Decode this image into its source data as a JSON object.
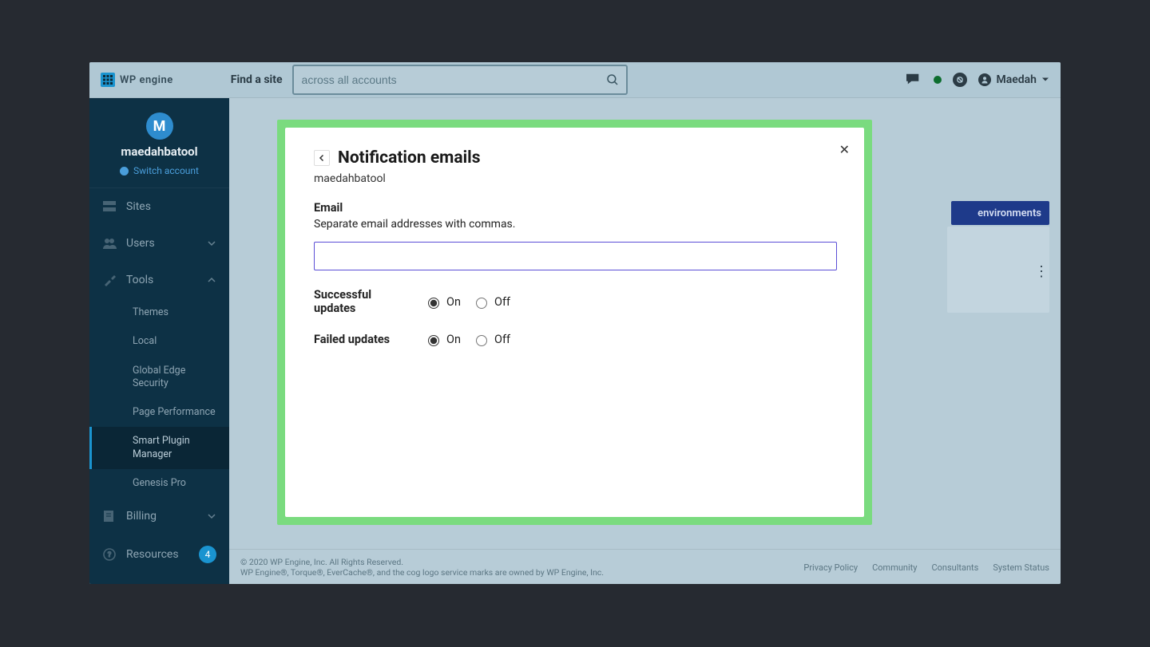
{
  "header": {
    "brand": "WP engine",
    "find_label": "Find a site",
    "search_placeholder": "across all accounts",
    "user_name": "Maedah"
  },
  "sidebar": {
    "avatar_letter": "M",
    "account_name": "maedahbatool",
    "switch_account": "Switch account",
    "nav": {
      "sites": "Sites",
      "users": "Users",
      "tools": "Tools",
      "billing": "Billing",
      "resources": "Resources",
      "resources_badge": "4"
    },
    "tools_sub": {
      "themes": "Themes",
      "local": "Local",
      "ges": "Global Edge Security",
      "page_perf": "Page Performance",
      "spm": "Smart Plugin Manager",
      "genesis": "Genesis Pro"
    }
  },
  "main": {
    "env_button": "environments"
  },
  "modal": {
    "title": "Notification emails",
    "subtitle": "maedahbatool",
    "email_label": "Email",
    "email_help": "Separate email addresses with commas.",
    "successful_label": "Successful updates",
    "failed_label": "Failed updates",
    "on": "On",
    "off": "Off"
  },
  "footer": {
    "copyright": "© 2020 WP Engine, Inc. All Rights Reserved.",
    "tm": "WP Engine®, Torque®, EverCache®, and the cog logo service marks are owned by WP Engine, Inc.",
    "links": {
      "privacy": "Privacy Policy",
      "community": "Community",
      "consultants": "Consultants",
      "status": "System Status"
    }
  }
}
